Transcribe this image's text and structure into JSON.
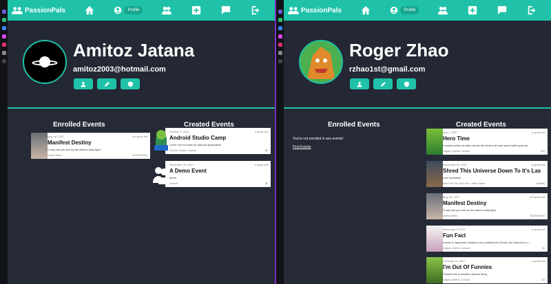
{
  "brand": "PassionPals",
  "nav": {
    "profile_label": "Profile"
  },
  "left": {
    "name": "Amitoz Jatana",
    "email": "amitoz2003@hotmail.com",
    "enrolled_title": "Enrolled Events",
    "created_title": "Created Events",
    "enrolled": [
      {
        "date": "May 26, 2027",
        "spots": "99 spots left",
        "title": "Manifest Destiny",
        "desc": "O say can you see by the dawn's early light",
        "loc": "United States",
        "price": "$1000000000"
      }
    ],
    "created": [
      {
        "date": "October 4, 2023",
        "spots": "2 spots left",
        "title": "Android Studio Camp",
        "desc": "Learn how to make an android application!",
        "loc": "Toronto, Ontario, Canada",
        "price": "$5"
      },
      {
        "date": "November 23, 2027",
        "spots": "3 spots left",
        "title": "A Demo Event",
        "desc": "demo",
        "loc": "Canada",
        "price": "$5"
      }
    ]
  },
  "right": {
    "name": "Roger Zhao",
    "email": "rzhao1st@gmail.com",
    "enrolled_title": "Enrolled Events",
    "created_title": "Created Events",
    "empty_text": "You're not enrolled in any events!",
    "find_link": "Find Events",
    "created": [
      {
        "date": "July 1, 2027",
        "spots": "4 spots left",
        "title": "Hero Time",
        "desc": "It started when an alien device did what it did and stuck itself upon his",
        "loc": "Calgary, Alberta, Canada",
        "price": "$10"
      },
      {
        "date": "November 24, 2027",
        "spots": "6 spots left",
        "title": "Shred This Universe Down To It's Las...",
        "desc": "I am inevitable",
        "loc": "New York City, New York, United States",
        "price": "$infinity"
      },
      {
        "date": "May 26, 2027",
        "spots": "99 spots left",
        "title": "Manifest Destiny",
        "desc": "O say can you see by the dawn's early light",
        "loc": "United States",
        "price": "$1000000000"
      },
      {
        "date": "December 5, 2027",
        "spots": "4 spots left",
        "title": "Fun Fact",
        "desc": "Lewve in Japanese romaji is not a palindrome (Dour), but Esperon is (...",
        "loc": "Calgary, Alberta, Canada",
        "price": "$2"
      },
      {
        "date": "February 16, 2027",
        "spots": "4 spots left",
        "title": "I'm Out Of Funnies",
        "desc": "Pricked this is another random thing",
        "loc": "Calgary, Alberta, Canada",
        "price": "$3"
      }
    ]
  },
  "colors": {
    "teal": "#1fc2a8",
    "bg": "#252a36",
    "sidebar": "#111318",
    "divider": "#7b2fbf"
  }
}
